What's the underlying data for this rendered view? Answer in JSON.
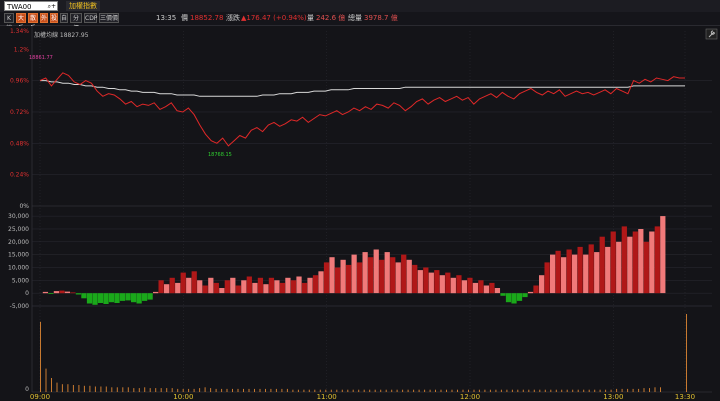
{
  "toolbar": {
    "symbol": "TWA00",
    "title": "加權指數",
    "buttons": [
      "K線",
      "大戶",
      "散戶",
      "外",
      "投",
      "自",
      "分價",
      "CDP",
      "三價價"
    ],
    "active_buttons": [
      1,
      2,
      3,
      4
    ]
  },
  "quote": {
    "time": "13:35",
    "price_label": "價",
    "price": "18852.78",
    "change_label": "漲跌",
    "change": "▲176.47 (+0.94%)",
    "volume_label": "量",
    "volume": "242.6 億",
    "total_label": "總量",
    "total_volume": "3978.7 億"
  },
  "colors": {
    "up": "#e02828",
    "down": "#1aa81a",
    "avg": "#d8d8d8",
    "grid": "#2c2c34",
    "volume": "#c87a30"
  },
  "icons": {
    "settings": "wrench-icon",
    "search": "search-icon"
  },
  "chart_data": {
    "type": "line",
    "legend": "加權均線 18827.95",
    "price_ticks": [
      "1.34%",
      "1.2%",
      "0.96%",
      "0.72%",
      "0.48%",
      "0.24%",
      "0%"
    ],
    "high_label": "18861.77",
    "low_label": "18768.15",
    "osc_ticks": [
      "30,000",
      "25,000",
      "20,000",
      "15,000",
      "10,000",
      "5,000",
      "0",
      "-5,000"
    ],
    "vol_ticks": [
      "0"
    ],
    "time_ticks": [
      "09:00",
      "10:00",
      "11:00",
      "12:00",
      "13:00",
      "13:30"
    ],
    "price_pct": [
      0.96,
      0.98,
      0.92,
      0.97,
      1.02,
      1.0,
      0.95,
      0.93,
      0.96,
      0.94,
      0.88,
      0.84,
      0.86,
      0.85,
      0.82,
      0.78,
      0.8,
      0.76,
      0.78,
      0.77,
      0.79,
      0.74,
      0.76,
      0.79,
      0.73,
      0.72,
      0.75,
      0.7,
      0.62,
      0.55,
      0.5,
      0.48,
      0.52,
      0.46,
      0.5,
      0.54,
      0.52,
      0.58,
      0.6,
      0.57,
      0.62,
      0.64,
      0.61,
      0.63,
      0.66,
      0.65,
      0.68,
      0.64,
      0.67,
      0.7,
      0.69,
      0.71,
      0.73,
      0.7,
      0.72,
      0.75,
      0.73,
      0.76,
      0.74,
      0.78,
      0.77,
      0.75,
      0.79,
      0.77,
      0.73,
      0.76,
      0.8,
      0.82,
      0.78,
      0.81,
      0.83,
      0.8,
      0.82,
      0.84,
      0.81,
      0.83,
      0.78,
      0.82,
      0.84,
      0.86,
      0.83,
      0.87,
      0.84,
      0.82,
      0.86,
      0.88,
      0.9,
      0.87,
      0.85,
      0.88,
      0.86,
      0.89,
      0.84,
      0.86,
      0.88,
      0.86,
      0.87,
      0.85,
      0.87,
      0.89,
      0.86,
      0.9,
      0.88,
      0.86,
      0.96,
      0.94,
      0.97,
      0.95,
      0.98,
      0.97,
      0.96,
      0.99,
      0.98,
      0.98
    ],
    "avg_pct": [
      0.96,
      0.96,
      0.95,
      0.95,
      0.94,
      0.94,
      0.93,
      0.93,
      0.92,
      0.92,
      0.91,
      0.91,
      0.9,
      0.9,
      0.89,
      0.89,
      0.88,
      0.88,
      0.87,
      0.87,
      0.87,
      0.86,
      0.86,
      0.86,
      0.85,
      0.85,
      0.85,
      0.85,
      0.84,
      0.84,
      0.84,
      0.84,
      0.84,
      0.84,
      0.84,
      0.84,
      0.84,
      0.84,
      0.84,
      0.85,
      0.85,
      0.85,
      0.86,
      0.86,
      0.86,
      0.87,
      0.87,
      0.87,
      0.88,
      0.88,
      0.88,
      0.89,
      0.89,
      0.89,
      0.89,
      0.9,
      0.9,
      0.9,
      0.9,
      0.9,
      0.9,
      0.9,
      0.9,
      0.9,
      0.91,
      0.91,
      0.91,
      0.91,
      0.91,
      0.91,
      0.91,
      0.91,
      0.91,
      0.91,
      0.91,
      0.91,
      0.91,
      0.91,
      0.91,
      0.91,
      0.91,
      0.91,
      0.91,
      0.91,
      0.91,
      0.91,
      0.91,
      0.91,
      0.91,
      0.91,
      0.91,
      0.91,
      0.91,
      0.91,
      0.91,
      0.91,
      0.91,
      0.91,
      0.91,
      0.91,
      0.91,
      0.91,
      0.91,
      0.91,
      0.92,
      0.92,
      0.92,
      0.92,
      0.92,
      0.92,
      0.92,
      0.92,
      0.92,
      0.92
    ],
    "osc": [
      0,
      500,
      -300,
      800,
      1000,
      600,
      300,
      -500,
      -2000,
      -4000,
      -4500,
      -3800,
      -4200,
      -3500,
      -3800,
      -3000,
      -2800,
      -3500,
      -4000,
      -3000,
      -2500,
      500,
      5000,
      3500,
      6000,
      4000,
      8000,
      6000,
      8500,
      5000,
      3000,
      6000,
      4000,
      2000,
      5000,
      6000,
      3000,
      5000,
      6500,
      4000,
      6000,
      3500,
      6000,
      5000,
      4000,
      6000,
      5000,
      6500,
      4000,
      6000,
      7000,
      8500,
      12000,
      14000,
      10000,
      13000,
      11000,
      15000,
      12000,
      16000,
      14000,
      17000,
      13000,
      16000,
      14000,
      12000,
      15000,
      13000,
      11000,
      9000,
      10000,
      8000,
      9000,
      7000,
      8000,
      6000,
      7000,
      5000,
      6000,
      4000,
      5000,
      3000,
      4000,
      2000,
      -1000,
      -3500,
      -4000,
      -3000,
      -1500,
      500,
      3000,
      7000,
      12000,
      15000,
      16500,
      14000,
      17000,
      15000,
      18000,
      15000,
      19000,
      16000,
      22000,
      18000,
      24000,
      20000,
      26000,
      22000,
      24000,
      25000,
      20000,
      24000,
      26000,
      30000
    ],
    "volume": [
      0.9,
      0.3,
      0.18,
      0.12,
      0.1,
      0.1,
      0.09,
      0.09,
      0.08,
      0.08,
      0.07,
      0.07,
      0.07,
      0.06,
      0.06,
      0.06,
      0.06,
      0.05,
      0.05,
      0.06,
      0.05,
      0.05,
      0.05,
      0.05,
      0.05,
      0.04,
      0.04,
      0.04,
      0.04,
      0.05,
      0.06,
      0.05,
      0.04,
      0.04,
      0.04,
      0.04,
      0.04,
      0.04,
      0.04,
      0.04,
      0.04,
      0.04,
      0.04,
      0.04,
      0.04,
      0.04,
      0.03,
      0.03,
      0.03,
      0.03,
      0.03,
      0.03,
      0.03,
      0.03,
      0.03,
      0.03,
      0.03,
      0.03,
      0.03,
      0.03,
      0.03,
      0.03,
      0.03,
      0.03,
      0.03,
      0.03,
      0.03,
      0.03,
      0.03,
      0.03,
      0.03,
      0.03,
      0.03,
      0.03,
      0.03,
      0.03,
      0.03,
      0.03,
      0.03,
      0.03,
      0.03,
      0.03,
      0.03,
      0.03,
      0.03,
      0.03,
      0.03,
      0.03,
      0.03,
      0.03,
      0.03,
      0.03,
      0.03,
      0.03,
      0.03,
      0.03,
      0.03,
      0.03,
      0.03,
      0.03,
      0.03,
      0.03,
      0.03,
      0.03,
      0.03,
      0.04,
      0.04,
      0.04,
      0.04,
      0.04,
      0.05,
      0.05,
      0.06,
      0.06,
      1.0
    ]
  }
}
